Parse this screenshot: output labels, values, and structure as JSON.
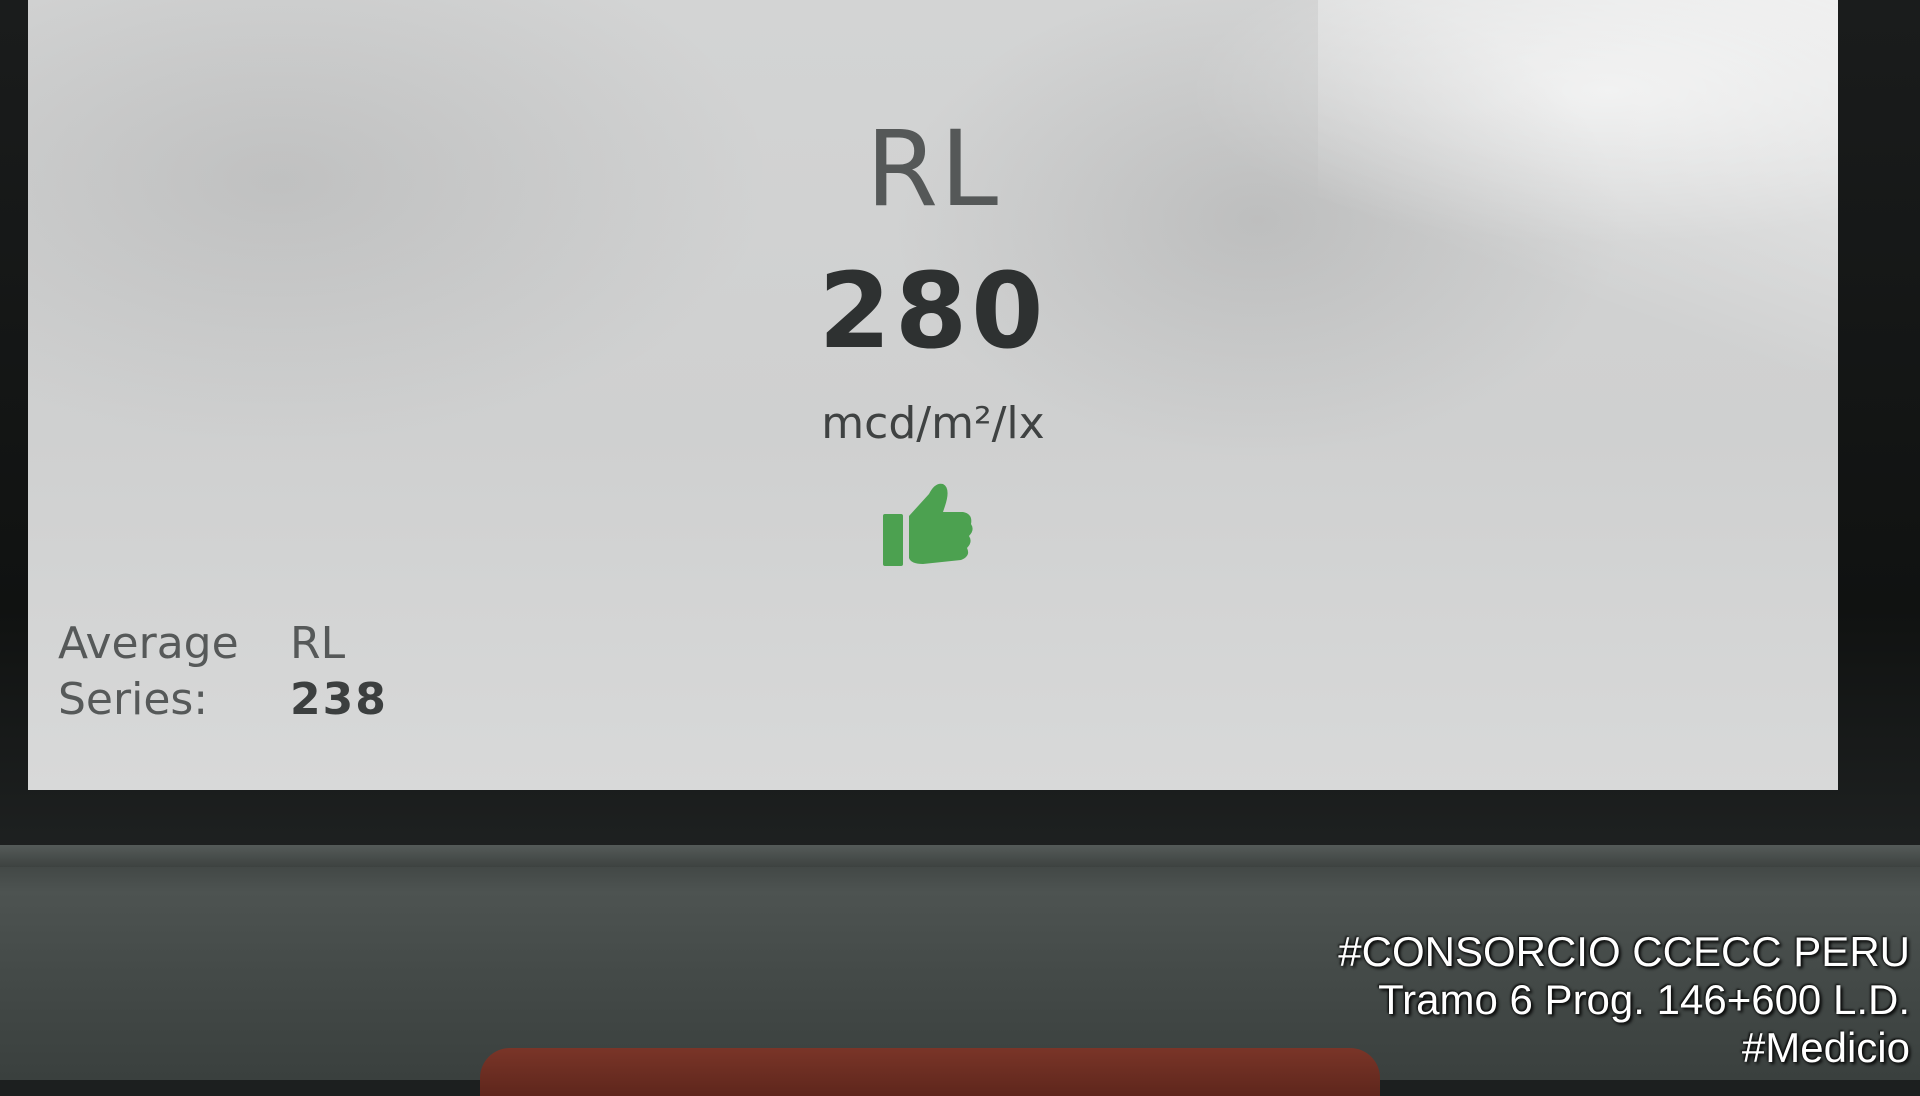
{
  "screen": {
    "title": "RL",
    "value": "280",
    "unit": "mcd/m²/lx",
    "status_icon": "thumbs-up-icon",
    "status_color": "#4ca150",
    "average": {
      "label": "Average",
      "series_label": "Series:",
      "metric": "RL",
      "value": "238"
    }
  },
  "watermark": {
    "line1": "#CONSORCIO CCECC PERU",
    "line2": "Tramo 6 Prog. 146+600 L.D.",
    "line3": "#Medicio"
  }
}
